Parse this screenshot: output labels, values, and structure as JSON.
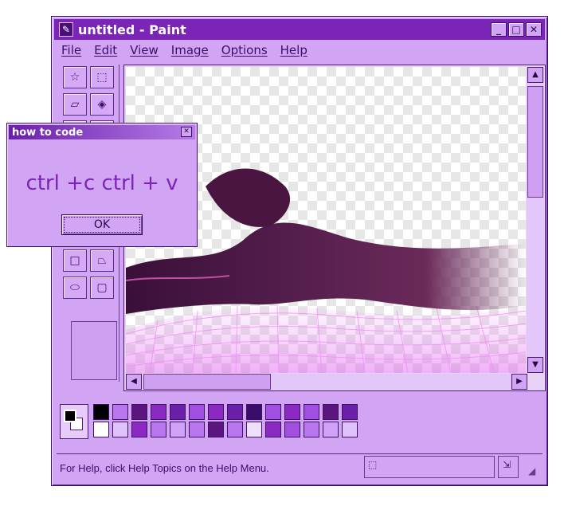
{
  "window": {
    "title": "untitled - Paint",
    "controls": [
      "minimize",
      "maximize",
      "close"
    ]
  },
  "menu": [
    "File",
    "Edit",
    "View",
    "Image",
    "Options",
    "Help"
  ],
  "status": {
    "help_text": "For Help, click Help Topics on the Help Menu."
  },
  "dialog": {
    "title": "how to code",
    "message": "ctrl +c ctrl + v",
    "ok_label": "OK"
  },
  "palette": {
    "foreground": "#000000",
    "background": "#ffffff",
    "row1": [
      "#000000",
      "#b877ef",
      "#5a167e",
      "#8a2ac2",
      "#6a1fa8",
      "#a04fe0",
      "#8a2ac2",
      "#6a1fa8",
      "#3b0d6a",
      "#a04fe0",
      "#8a2ac2",
      "#a04fe0",
      "#5a167e",
      "#6a1fa8"
    ],
    "row2": [
      "#ffffff",
      "#e0c2fb",
      "#8a2ac2",
      "#b877ef",
      "#d0a2f7",
      "#b877ef",
      "#5a167e",
      "#b877ef",
      "#f0e0ff",
      "#8a2ac2",
      "#a04fe0",
      "#b877ef",
      "#d0a2f7",
      "#e0c2fb"
    ]
  },
  "colors": {
    "title_bar": "#7a24b8",
    "chrome": "#d2a4f4",
    "accent_text": "#7a24b8"
  }
}
